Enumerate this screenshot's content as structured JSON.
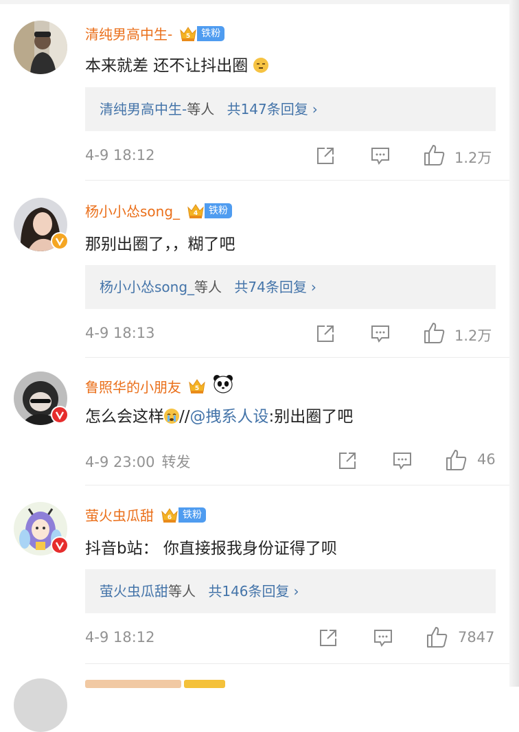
{
  "icons": {
    "repost": "repost-icon",
    "comment": "comment-icon",
    "like": "like-icon",
    "crown": "crown-icon",
    "panda": "panda-icon",
    "verified": "verified-icon"
  },
  "colors": {
    "username": "#ea6f1a",
    "link": "#4474a9",
    "meta": "#929292",
    "reply_bg": "#f2f2f2",
    "fan_tag": "#4f9cf0"
  },
  "comments": [
    {
      "username": "清纯男高中生-",
      "crown_level": "5",
      "fan_tag": "铁粉",
      "text": "本来就差 还不让抖出圈",
      "reply_names": "清纯男高中生-",
      "reply_others": "等人",
      "reply_count": "共147条回复",
      "reply_arrow": "›",
      "time": "4-9 18:12",
      "likes": "1.2万"
    },
    {
      "username": "杨小小怂song_",
      "crown_level": "4",
      "fan_tag": "铁粉",
      "text": "那别出圈了，，糊了吧",
      "reply_names": "杨小小怂song_",
      "reply_others": "等人",
      "reply_count": "共74条回复",
      "reply_arrow": "›",
      "time": "4-9 18:13",
      "likes": "1.2万"
    },
    {
      "username": "鲁照华的小朋友",
      "crown_level": "5",
      "text_a": "怎么会这样",
      "text_b": "//",
      "mention": "@拽系人设",
      "text_c": ":别出圈了吧",
      "time": "4-9 23:00",
      "repost_label": "转发",
      "likes": "46"
    },
    {
      "username": "萤火虫瓜甜",
      "crown_level": "6",
      "fan_tag": "铁粉",
      "text": "抖音b站： 你直接报我身份证得了呗",
      "reply_names": "萤火虫瓜甜",
      "reply_others": "等人",
      "reply_count": "共146条回复",
      "reply_arrow": "›",
      "time": "4-9 18:12",
      "likes": "7847"
    }
  ]
}
